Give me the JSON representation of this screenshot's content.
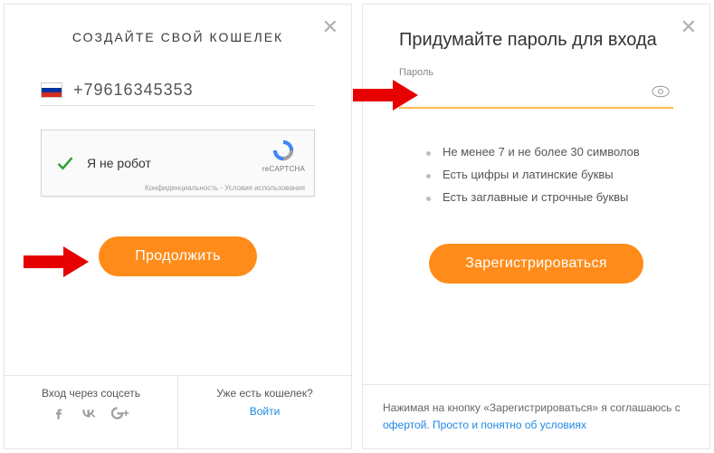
{
  "left": {
    "title": "СОЗДАЙТЕ СВОЙ КОШЕЛЕК",
    "phone": "+79616345353",
    "captcha_label": "Я не робот",
    "captcha_brand": "reCAPTCHA",
    "captcha_terms": "Конфиденциальность - Условия использования",
    "button": "Продолжить",
    "footer_social_label": "Вход через соцсеть",
    "footer_have_wallet": "Уже есть кошелек?",
    "footer_login": "Войти"
  },
  "right": {
    "title": "Придумайте пароль для входа",
    "password_label": "Пароль",
    "rules": [
      "Не менее 7 и не более 30 символов",
      "Есть цифры и латинские буквы",
      "Есть заглавные и строчные буквы"
    ],
    "button": "Зарегистрироваться",
    "disclaimer_prefix": "Нажимая на кнопку «Зарегистрироваться» я соглашаюсь с ",
    "disclaimer_link1": "офертой",
    "disclaimer_mid": ". ",
    "disclaimer_link2": "Просто и понятно об условиях"
  },
  "icons": {
    "close": "close-icon",
    "flag": "flag-ru-icon",
    "check": "checkmark-icon",
    "recaptcha": "recaptcha-icon",
    "eye": "eye-icon",
    "fb": "facebook-icon",
    "vk": "vk-icon",
    "gplus": "google-plus-icon"
  },
  "colors": {
    "accent": "#ff8c1a",
    "link": "#1e88e5",
    "underline": "#ffb84d"
  }
}
